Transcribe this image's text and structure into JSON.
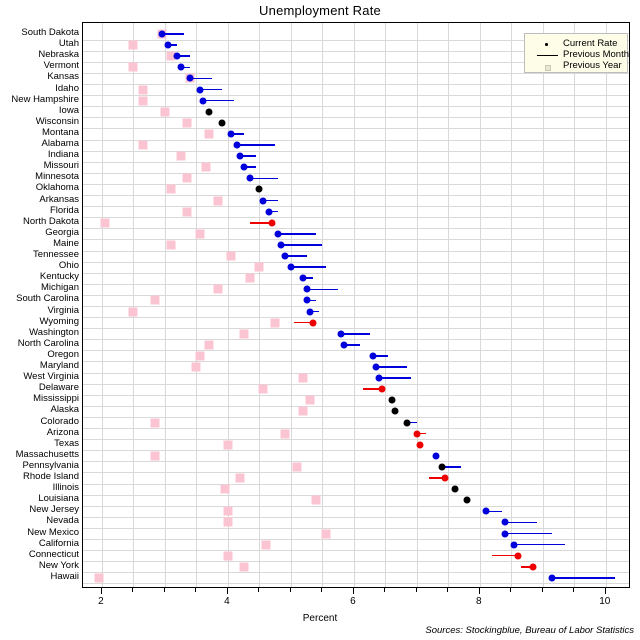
{
  "chart_data": {
    "type": "scatter",
    "title": "Unemployment Rate",
    "xlabel": "Percent",
    "ylabel": "",
    "xlim": [
      1.7,
      10.4
    ],
    "xticks": [
      2,
      4,
      6,
      8,
      10
    ],
    "xtick_labels": [
      "2",
      "4",
      "6",
      "8",
      "10"
    ],
    "grid": true,
    "legend_position": "top-right",
    "legend": [
      {
        "name": "Current Rate",
        "marker": "dot"
      },
      {
        "name": "Previous Month",
        "marker": "line"
      },
      {
        "name": "Previous Year",
        "marker": "square"
      }
    ],
    "source": "Sources: Stockingblue, Bureau of Labor Statistics",
    "categories": [
      "South Dakota",
      "Utah",
      "Nebraska",
      "Vermont",
      "Kansas",
      "Idaho",
      "New Hampshire",
      "Iowa",
      "Wisconsin",
      "Montana",
      "Alabama",
      "Indiana",
      "Missouri",
      "Minnesota",
      "Oklahoma",
      "Arkansas",
      "Florida",
      "North Dakota",
      "Georgia",
      "Maine",
      "Tennessee",
      "Ohio",
      "Kentucky",
      "Michigan",
      "South Carolina",
      "Virginia",
      "Wyoming",
      "Washington",
      "North Carolina",
      "Oregon",
      "Maryland",
      "West Virginia",
      "Delaware",
      "Mississippi",
      "Alaska",
      "Colorado",
      "Arizona",
      "Texas",
      "Massachusetts",
      "Pennsylvania",
      "Rhode Island",
      "Illinois",
      "Louisiana",
      "New Jersey",
      "Nevada",
      "New Mexico",
      "California",
      "Connecticut",
      "New York",
      "Hawaii"
    ],
    "series": [
      {
        "name": "Current Rate",
        "values": [
          2.95,
          3.05,
          3.2,
          3.25,
          3.4,
          3.55,
          3.6,
          3.7,
          3.9,
          4.05,
          4.15,
          4.2,
          4.25,
          4.35,
          4.5,
          4.55,
          4.65,
          4.7,
          4.8,
          4.85,
          4.9,
          5.0,
          5.2,
          5.25,
          5.25,
          5.3,
          5.35,
          5.8,
          5.85,
          6.3,
          6.35,
          6.4,
          6.45,
          6.6,
          6.65,
          6.85,
          7.0,
          7.05,
          7.3,
          7.4,
          7.45,
          7.6,
          7.8,
          8.1,
          8.4,
          8.4,
          8.55,
          8.6,
          8.85,
          9.15
        ]
      },
      {
        "name": "Previous Month",
        "values": [
          3.3,
          3.2,
          3.4,
          3.4,
          3.75,
          3.9,
          4.1,
          3.7,
          3.9,
          4.25,
          4.75,
          4.45,
          4.45,
          4.8,
          4.5,
          4.8,
          4.8,
          4.35,
          5.4,
          5.5,
          5.25,
          5.55,
          5.35,
          5.75,
          5.4,
          5.45,
          5.05,
          6.25,
          6.1,
          6.55,
          6.85,
          6.9,
          6.15,
          6.6,
          6.65,
          7.0,
          7.15,
          7.05,
          7.3,
          7.7,
          7.2,
          7.6,
          7.8,
          8.35,
          8.9,
          9.15,
          9.35,
          8.2,
          8.65,
          10.15
        ]
      },
      {
        "name": "Previous Year",
        "values": [
          2.95,
          2.5,
          3.1,
          2.5,
          3.4,
          2.65,
          2.65,
          3.0,
          3.35,
          3.7,
          2.65,
          3.25,
          3.65,
          3.35,
          3.1,
          3.85,
          3.35,
          2.05,
          3.55,
          3.1,
          4.05,
          4.5,
          4.35,
          3.85,
          2.85,
          2.5,
          4.75,
          4.25,
          3.7,
          3.55,
          3.5,
          5.2,
          4.55,
          5.3,
          5.2,
          2.85,
          4.9,
          4.0,
          2.85,
          5.1,
          4.2,
          3.95,
          5.4,
          4.0,
          4.0,
          5.55,
          4.6,
          4.0,
          4.25,
          1.95
        ]
      }
    ],
    "current_rate_colors": [
      "blue",
      "blue",
      "blue",
      "blue",
      "blue",
      "blue",
      "blue",
      "black",
      "black",
      "blue",
      "blue",
      "blue",
      "blue",
      "blue",
      "black",
      "blue",
      "blue",
      "red",
      "blue",
      "blue",
      "blue",
      "blue",
      "blue",
      "blue",
      "blue",
      "blue",
      "red",
      "blue",
      "blue",
      "blue",
      "blue",
      "blue",
      "red",
      "black",
      "black",
      "black",
      "red",
      "red",
      "blue",
      "black",
      "red",
      "black",
      "black",
      "blue",
      "blue",
      "blue",
      "blue",
      "red",
      "red",
      "blue"
    ]
  },
  "colors": {
    "current_blue": "#0000dd",
    "current_red": "#ee0000",
    "current_black": "#000000",
    "previous_year": "#fbc4d2",
    "grid": "#d9d9d9",
    "axis": "#000000",
    "legend_background": "#fdfde8"
  }
}
